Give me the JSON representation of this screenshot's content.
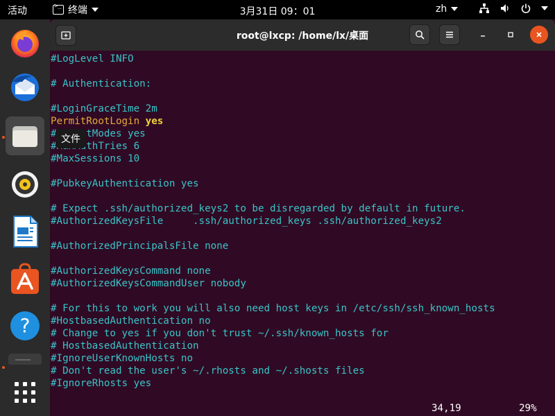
{
  "topbar": {
    "activities": "活动",
    "app_name": "终端",
    "clock": "3月31日  09：01",
    "lang": "zh"
  },
  "dock": {
    "tooltip": "文件",
    "items": [
      {
        "name": "firefox-icon"
      },
      {
        "name": "thunderbird-icon"
      },
      {
        "name": "files-icon"
      },
      {
        "name": "rhythmbox-icon"
      },
      {
        "name": "libreoffice-writer-icon"
      },
      {
        "name": "app-center-icon"
      },
      {
        "name": "help-icon"
      }
    ]
  },
  "window": {
    "title": "root@lxcp: /home/lx/桌面"
  },
  "terminal": {
    "lines": [
      "#LogLevel INFO",
      "",
      "# Authentication:",
      "",
      "#LoginGraceTime 2m",
      "",
      "#StrictModes yes",
      "#MaxAuthTries 6",
      "#MaxSessions 10",
      "",
      "#PubkeyAuthentication yes",
      "",
      "# Expect .ssh/authorized_keys2 to be disregarded by default in future.",
      "#AuthorizedKeysFile     .ssh/authorized_keys .ssh/authorized_keys2",
      "",
      "#AuthorizedPrincipalsFile none",
      "",
      "#AuthorizedKeysCommand none",
      "#AuthorizedKeysCommandUser nobody",
      "",
      "# For this to work you will also need host keys in /etc/ssh/ssh_known_hosts",
      "#HostbasedAuthentication no",
      "# Change to yes if you don't trust ~/.ssh/known_hosts for",
      "# HostbasedAuthentication",
      "#IgnoreUserKnownHosts no",
      "# Don't read the user's ~/.rhosts and ~/.shosts files",
      "#IgnoreRhosts yes"
    ],
    "permit_key": "PermitRootLogin",
    "permit_value": "yes",
    "cursor_pos": "34,19",
    "scroll_pct": "29%"
  }
}
